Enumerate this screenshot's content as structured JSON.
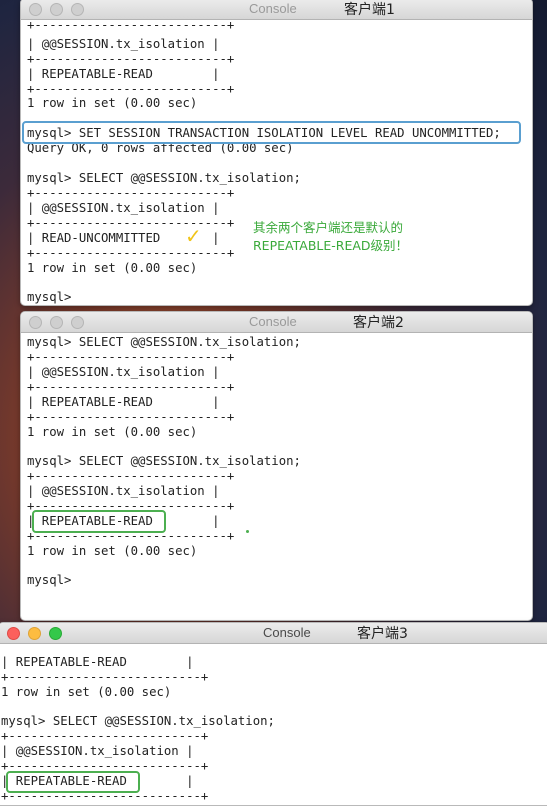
{
  "app_title": "Console",
  "windows": [
    {
      "caption": "客户端1",
      "lines": [
        "+--------------------------+",
        "| @@SESSION.tx_isolation |",
        "+--------------------------+",
        "| REPEATABLE-READ        |",
        "+--------------------------+",
        "1 row in set (0.00 sec)",
        "",
        "mysql> SET SESSION TRANSACTION ISOLATION LEVEL READ UNCOMMITTED;",
        "Query OK, 0 rows affected (0.00 sec)",
        "",
        "mysql> SELECT @@SESSION.tx_isolation;",
        "+--------------------------+",
        "| @@SESSION.tx_isolation |",
        "+--------------------------+",
        "| READ-UNCOMMITTED       |",
        "+--------------------------+",
        "1 row in set (0.00 sec)",
        "",
        "mysql>"
      ],
      "annotation": [
        "其余两个客户端还是默认的",
        "REPEATABLE-READ级别！"
      ],
      "check_glyph": "✓"
    },
    {
      "caption": "客户端2",
      "lines": [
        "mysql> SELECT @@SESSION.tx_isolation;",
        "+--------------------------+",
        "| @@SESSION.tx_isolation |",
        "+--------------------------+",
        "| REPEATABLE-READ        |",
        "+--------------------------+",
        "1 row in set (0.00 sec)",
        "",
        "mysql> SELECT @@SESSION.tx_isolation;",
        "+--------------------------+",
        "| @@SESSION.tx_isolation |",
        "+--------------------------+",
        "| REPEATABLE-READ        |",
        "+--------------------------+",
        "1 row in set (0.00 sec)",
        "",
        "mysql>"
      ]
    },
    {
      "caption": "客户端3",
      "lines": [
        "| REPEATABLE-READ        |",
        "+--------------------------+",
        "1 row in set (0.00 sec)",
        "",
        "mysql> SELECT @@SESSION.tx_isolation;",
        "+--------------------------+",
        "| @@SESSION.tx_isolation |",
        "+--------------------------+",
        "| REPEATABLE-READ        |",
        "+--------------------------+"
      ]
    }
  ],
  "colors": {
    "highlight_blue": "#5a9fd0",
    "highlight_green": "#4caf50",
    "annotation_green": "#3aa93a",
    "check_yellow": "#f0c419"
  }
}
